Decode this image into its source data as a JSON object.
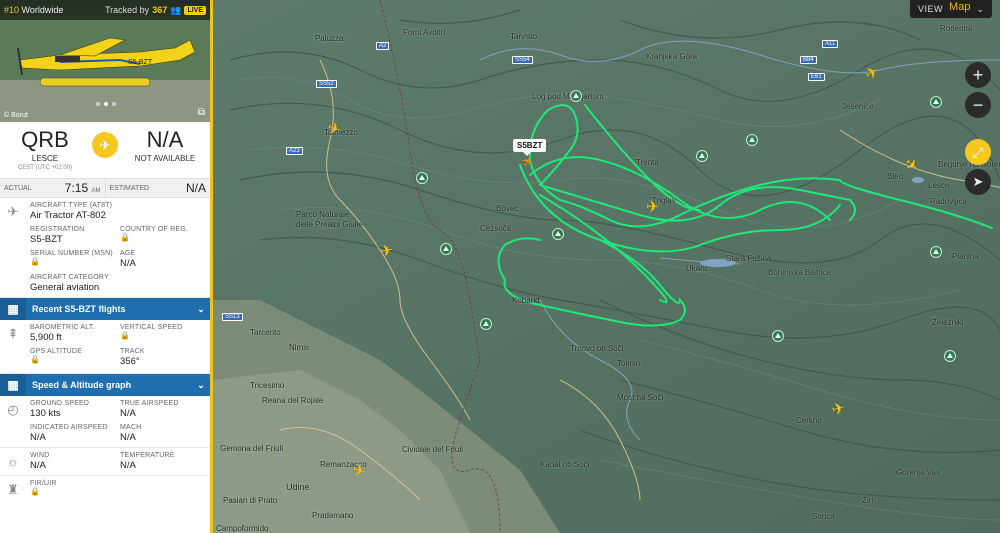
{
  "photo": {
    "rank": "#10",
    "rank_suffix": "Worldwide",
    "tracked_prefix": "Tracked by",
    "tracked_count": "367",
    "live": "LIVE",
    "credit": "© Borut"
  },
  "route": {
    "origin_code": "QRB",
    "origin_name": "LESCE",
    "origin_tz": "CEST (UTC +02:00)",
    "dest_code": "N/A",
    "dest_name": "NOT AVAILABLE"
  },
  "times": {
    "actual_label": "ACTUAL",
    "actual_time": "7:15",
    "actual_ampm": "AM",
    "estimated_label": "ESTIMATED",
    "estimated_time": "N/A"
  },
  "aircraft": {
    "type_label": "AIRCRAFT TYPE (AT8T)",
    "type_value": "Air Tractor AT-802",
    "reg_label": "REGISTRATION",
    "reg_value": "S5-BZT",
    "country_label": "COUNTRY OF REG.",
    "msn_label": "SERIAL NUMBER (MSN)",
    "age_label": "AGE",
    "age_value": "N/A",
    "category_label": "AIRCRAFT CATEGORY",
    "category_value": "General aviation"
  },
  "sections": {
    "recent_flights": "Recent S5-BZT flights",
    "speed_alt_graph": "Speed & Altitude graph"
  },
  "altitude": {
    "baro_label": "BAROMETRIC ALT.",
    "baro_value": "5,900 ft",
    "vs_label": "VERTICAL SPEED",
    "gps_label": "GPS ALTITUDE",
    "track_label": "TRACK",
    "track_value": "356°"
  },
  "speed": {
    "gs_label": "GROUND SPEED",
    "gs_value": "130 kts",
    "tas_label": "TRUE AIRSPEED",
    "tas_value": "N/A",
    "ias_label": "INDICATED AIRSPEED",
    "ias_value": "N/A",
    "mach_label": "MACH",
    "mach_value": "N/A"
  },
  "weather": {
    "wind_label": "WIND",
    "wind_value": "N/A",
    "temp_label": "TEMPERATURE",
    "temp_value": "N/A"
  },
  "fir": {
    "label": "FIR/UIR"
  },
  "map": {
    "view_label": "VIEW",
    "view_value": "Map",
    "callsign": "S5BZT",
    "places": [
      "Paluzza",
      "Tolmezzo",
      "Forni Avoltri",
      "Tarvisio",
      "Kranjska Gora",
      "Jesenice",
      "Begunje na Gorenjskem",
      "Bled",
      "Lesce",
      "Radovljica",
      "Bohinjska Bistrica",
      "Stara Fužina",
      "Ukanc",
      "Trenta",
      "Bovec",
      "Cezsoča",
      "Log pod Mangartom",
      "Kobarid",
      "Tolmin",
      "Most na Soči",
      "Cividale del Friuli",
      "Udine",
      "Tarcento",
      "Nimis",
      "Tricesimo",
      "Reana del Rojale",
      "Gemona del Friuli",
      "Remanzacco",
      "Pasian di Prato",
      "Pradamano",
      "Campoformido",
      "Kanal ob Soči",
      "Cerkno",
      "Gorenja Vas",
      "Železniki",
      "Žiri",
      "Sorica",
      "Planina",
      "Rodental",
      "Parco Naturale delle Prealpi Giulie",
      "Triglav",
      "Trnovo ob Soči"
    ],
    "roads": [
      "A23",
      "SS13",
      "A2",
      "B84",
      "A11",
      "E61",
      "SS54",
      "SS52"
    ],
    "accent": "#00e676",
    "brand": "#f2c319"
  }
}
